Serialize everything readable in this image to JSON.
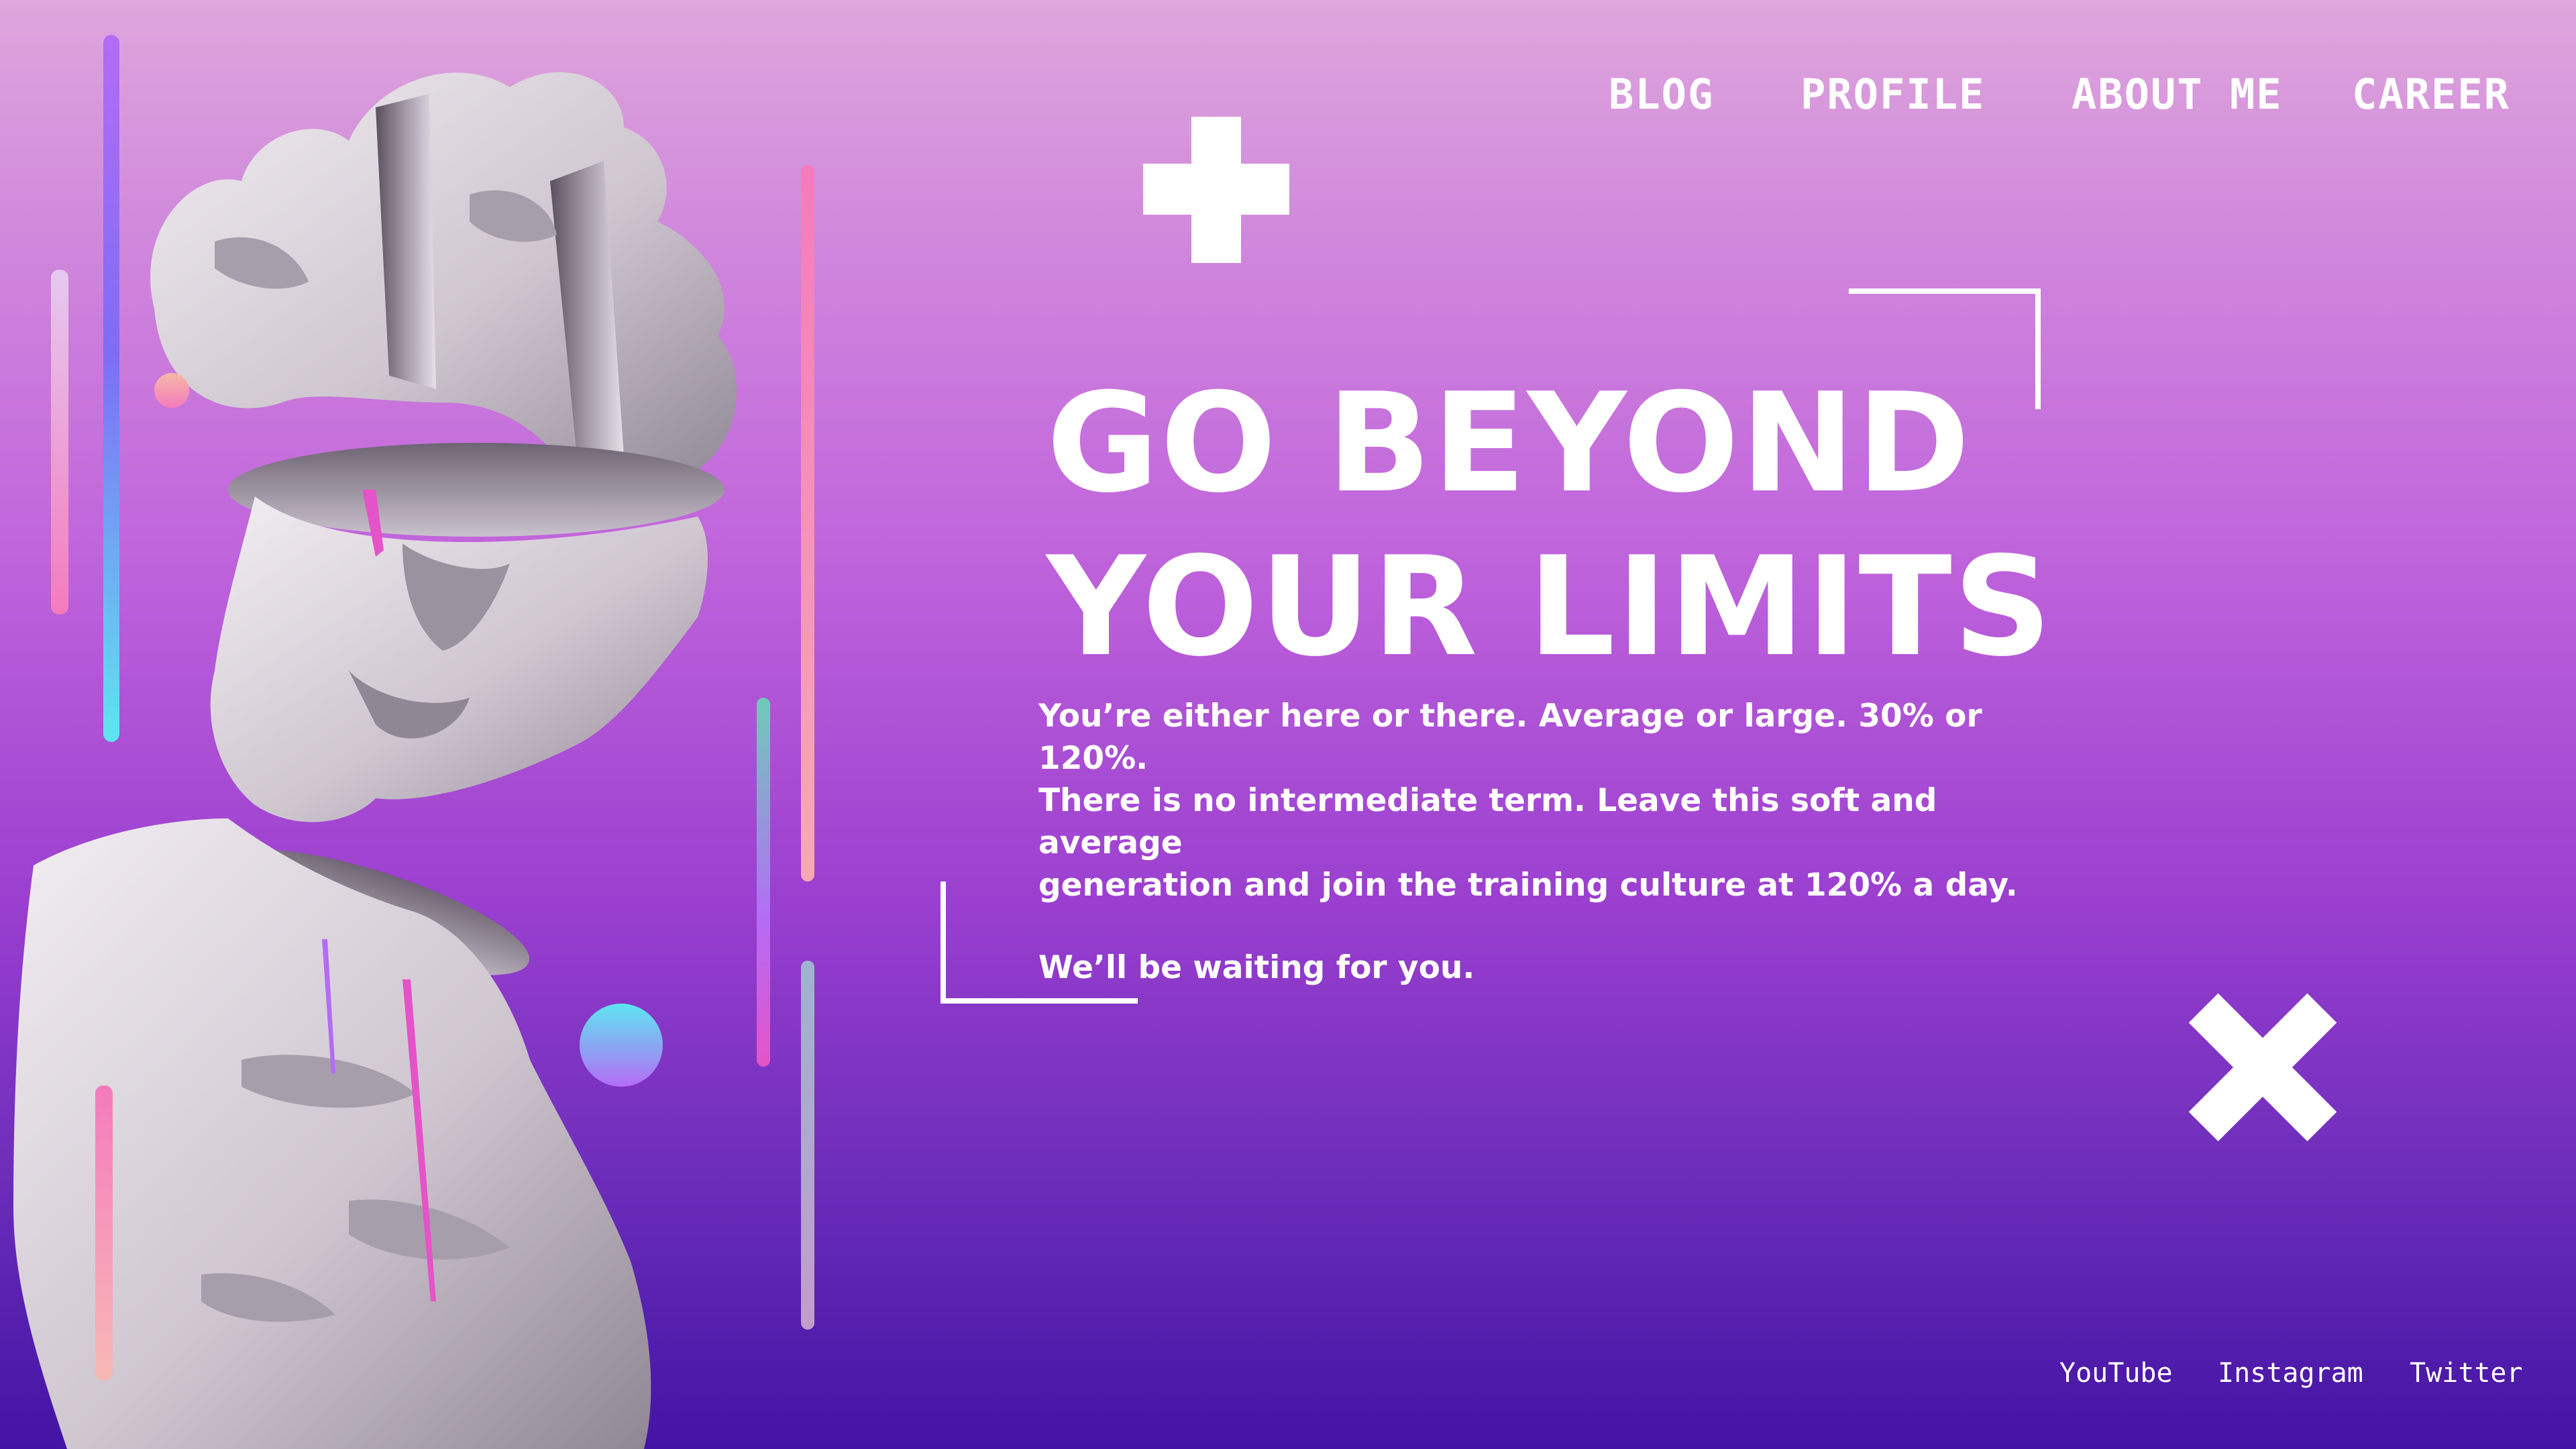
{
  "nav": {
    "items": [
      {
        "label": "BLOG"
      },
      {
        "label": "PROFILE"
      },
      {
        "label": "ABOUT ME"
      },
      {
        "label": "CAREER"
      }
    ]
  },
  "hero": {
    "title_line1": "GO BEYOND",
    "title_line2": "YOUR LIMITS",
    "body_line1": "You’re either here or there. Average or large. 30% or 120%.",
    "body_line2": "There is no intermediate term. Leave this soft and average",
    "body_line3": "generation and join the training culture at 120% a day.",
    "closing": "We’ll be waiting for you."
  },
  "social": {
    "links": [
      {
        "label": "YouTube"
      },
      {
        "label": "Instagram"
      },
      {
        "label": "Twitter"
      }
    ]
  },
  "colors": {
    "background_top": "#dea6dc",
    "background_bottom": "#4313a4",
    "text": "#ffffff",
    "accent_pink": "#f47bbd",
    "accent_cyan": "#5ee6f0",
    "accent_violet": "#b46cf5"
  },
  "icons": {
    "plus": "plus-icon",
    "cross": "x-icon"
  }
}
